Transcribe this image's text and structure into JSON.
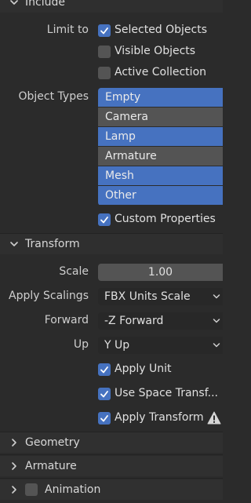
{
  "sections": {
    "include": {
      "title": "Include"
    },
    "transform": {
      "title": "Transform"
    },
    "geometry": {
      "title": "Geometry"
    },
    "armature": {
      "title": "Armature"
    },
    "animation": {
      "title": "Animation",
      "enabled": false
    }
  },
  "include": {
    "limit_to_label": "Limit to",
    "limit_options": [
      {
        "label": "Selected Objects",
        "checked": true
      },
      {
        "label": "Visible Objects",
        "checked": false
      },
      {
        "label": "Active Collection",
        "checked": false
      }
    ],
    "object_types_label": "Object Types",
    "object_types": [
      {
        "label": "Empty",
        "selected": true
      },
      {
        "label": "Camera",
        "selected": false
      },
      {
        "label": "Lamp",
        "selected": true
      },
      {
        "label": "Armature",
        "selected": false
      },
      {
        "label": "Mesh",
        "selected": true
      },
      {
        "label": "Other",
        "selected": true
      }
    ],
    "custom_properties": {
      "label": "Custom Properties",
      "checked": true
    }
  },
  "transform": {
    "scale_label": "Scale",
    "scale_value": "1.00",
    "apply_scalings_label": "Apply Scalings",
    "apply_scalings_value": "FBX Units Scale",
    "forward_label": "Forward",
    "forward_value": "-Z Forward",
    "up_label": "Up",
    "up_value": "Y Up",
    "apply_unit": {
      "label": "Apply Unit",
      "checked": true
    },
    "use_space_transform": {
      "label": "Use Space Transf...",
      "checked": true
    },
    "apply_transform": {
      "label": "Apply Transform",
      "checked": true
    }
  },
  "colors": {
    "accent": "#4672c0",
    "background": "#2b2b2b",
    "unselected": "#545454"
  },
  "icons": [
    "chevron-down-icon",
    "chevron-right-icon",
    "checkmark-icon",
    "warning-icon",
    "dropdown-arrow-icon"
  ]
}
